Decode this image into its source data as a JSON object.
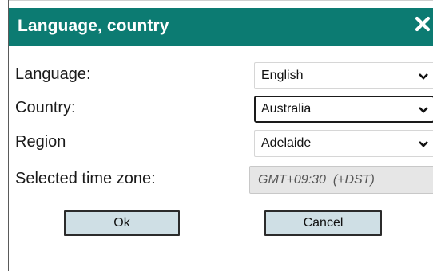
{
  "dialog": {
    "title": "Language, country",
    "close_icon": "close-icon",
    "accent_color": "#0c7b72"
  },
  "fields": {
    "language": {
      "label": "Language:",
      "value": "English"
    },
    "country": {
      "label": "Country:",
      "value": "Australia"
    },
    "region": {
      "label": "Region",
      "value": "Adelaide"
    },
    "timezone": {
      "label": "Selected time zone:",
      "value": "GMT+09:30  (+DST)"
    }
  },
  "buttons": {
    "ok_label": "Ok",
    "cancel_label": "Cancel"
  }
}
